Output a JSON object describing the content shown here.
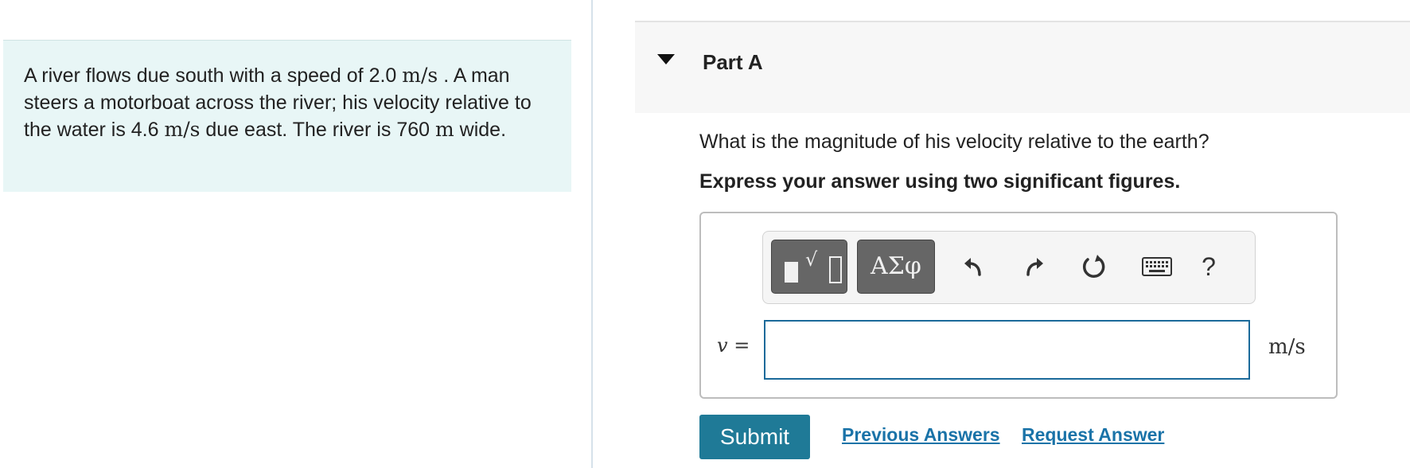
{
  "problem": {
    "text_1": "A river flows due south with a speed of 2.0 ",
    "unit_1": "m/s",
    "text_2": " . A man steers a motorboat across the river; his velocity relative to the water is 4.6 ",
    "unit_2": "m/s",
    "text_3": " due east. The river is 760 ",
    "unit_3": "m",
    "text_4": " wide."
  },
  "part": {
    "title": "Part A",
    "question": "What is the magnitude of his velocity relative to the earth?",
    "instruction": "Express your answer using two significant figures."
  },
  "toolbar": {
    "templates_icon": "templates-icon",
    "symbols_label": "ΑΣφ",
    "undo_icon": "undo-icon",
    "redo_icon": "redo-icon",
    "reset_icon": "reset-icon",
    "keyboard_icon": "keyboard-icon",
    "help_label": "?"
  },
  "answer": {
    "variable": "v",
    "equals": "=",
    "value": "",
    "unit": "m/s"
  },
  "actions": {
    "submit_label": "Submit",
    "previous_answers_label": "Previous Answers",
    "request_answer_label": "Request Answer"
  },
  "colors": {
    "problem_background": "#e8f6f6",
    "accent": "#1f7a97",
    "link": "#1a73a8",
    "input_border": "#1b6a9a"
  }
}
